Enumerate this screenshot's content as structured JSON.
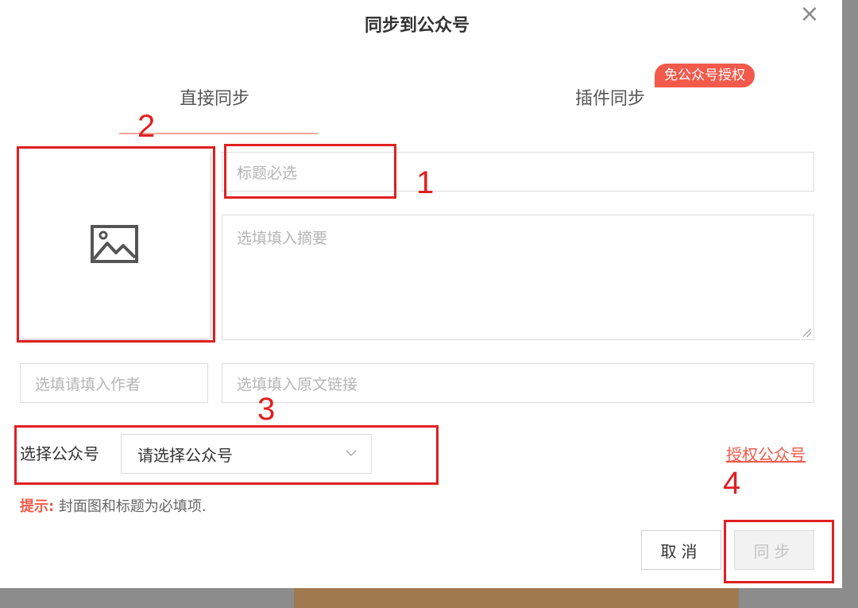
{
  "dialog": {
    "title": "同步到公众号",
    "close_glyph": "×"
  },
  "tabs": [
    {
      "label": "直接同步",
      "active": true
    },
    {
      "label": "插件同步",
      "active": false,
      "badge": "免公众号授权"
    }
  ],
  "cover": {
    "icon": "image-placeholder-icon"
  },
  "fields": {
    "title_placeholder": "标题必选",
    "summary_placeholder": "选填填入摘要",
    "author_placeholder": "选填请填入作者",
    "link_placeholder": "选填填入原文链接"
  },
  "account": {
    "label": "选择公众号",
    "selected": "请选择公众号",
    "auth_link": "授权公众号"
  },
  "hint": {
    "label": "提示:",
    "text": " 封面图和标题为必填项."
  },
  "buttons": {
    "cancel": "取消",
    "sync": "同步"
  },
  "annotations": [
    "1",
    "2",
    "3",
    "4"
  ],
  "colors": {
    "accent": "#f05a48",
    "annotation": "#e02020",
    "badge": "#f35a4b"
  }
}
